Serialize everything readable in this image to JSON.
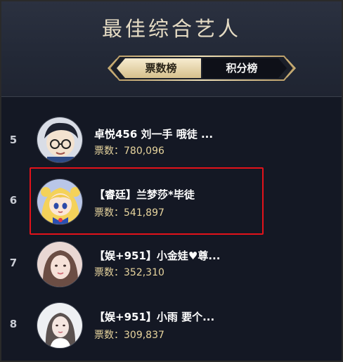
{
  "title": "最佳综合艺人",
  "tabs": [
    {
      "label": "票数榜",
      "active": true
    },
    {
      "label": "积分榜",
      "active": false
    }
  ],
  "votes_prefix": "票数：",
  "rows": [
    {
      "rank": "5",
      "name": "卓悦456 刘一手 哦徒 ...",
      "votes": "780,096",
      "avatar": "anime-boy-glasses-avatar"
    },
    {
      "rank": "6",
      "name": "【睿廷】兰梦莎*毕徒",
      "votes": "541,897",
      "avatar": "sailor-moon-avatar",
      "highlighted": true
    },
    {
      "rank": "7",
      "name": "【娱+951】小金娃♥尊...",
      "votes": "352,310",
      "avatar": "girl-photo-avatar"
    },
    {
      "rank": "8",
      "name": "【娱+951】小雨 要个...",
      "votes": "309,837",
      "avatar": "girl-white-photo-avatar"
    }
  ],
  "colors": {
    "background": "#141824",
    "header": "#232937",
    "gold": "#e8d59e",
    "highlight_border": "#e3121a"
  }
}
